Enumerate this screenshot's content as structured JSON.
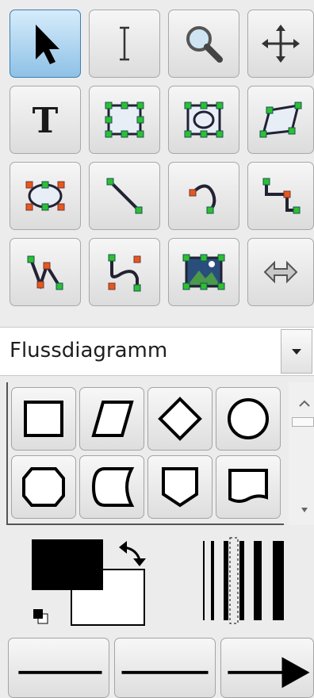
{
  "toolbar": {
    "tools": [
      {
        "icon": "arrow-pointer-icon",
        "active": true
      },
      {
        "icon": "text-cursor-icon"
      },
      {
        "icon": "magnifier-zoom-icon"
      },
      {
        "icon": "move-arrows-icon"
      },
      {
        "icon": "text-tool-icon"
      },
      {
        "icon": "rectangle-tool-icon"
      },
      {
        "icon": "ellipse-in-rect-tool-icon"
      },
      {
        "icon": "parallelogram-tool-icon"
      },
      {
        "icon": "ellipse-tool-icon"
      },
      {
        "icon": "line-tool-icon"
      },
      {
        "icon": "arc-tool-icon"
      },
      {
        "icon": "orthogonal-connector-icon"
      },
      {
        "icon": "polyline-tool-icon"
      },
      {
        "icon": "bezier-curve-icon"
      },
      {
        "icon": "image-tool-icon"
      },
      {
        "icon": "outline-arrow-icon"
      }
    ]
  },
  "sheet_selector": {
    "selected": "Flussdiagramm",
    "arrow_icon": "chevron-down-icon"
  },
  "shapes": [
    {
      "icon": "process-box-icon"
    },
    {
      "icon": "data-parallelogram-icon"
    },
    {
      "icon": "decision-diamond-icon"
    },
    {
      "icon": "connector-circle-icon"
    },
    {
      "icon": "preparation-hexagon-icon"
    },
    {
      "icon": "stored-data-icon"
    },
    {
      "icon": "offpage-reference-icon"
    },
    {
      "icon": "document-shape-icon"
    }
  ],
  "colors": {
    "foreground": "#000000",
    "background": "#ffffff",
    "accent": "#3c7fb1"
  },
  "line_styles": [
    {
      "icon": "line-start-plain-icon"
    },
    {
      "icon": "line-style-plain-icon"
    },
    {
      "icon": "line-end-arrow-icon"
    }
  ]
}
